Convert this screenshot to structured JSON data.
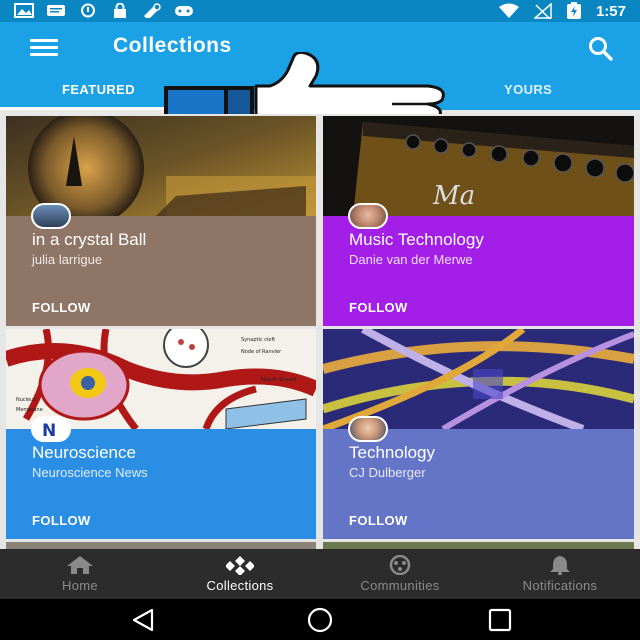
{
  "status_bar": {
    "time": "1:57",
    "icons": [
      "gallery-icon",
      "message-icon",
      "sync-icon",
      "lock-icon",
      "tool-icon",
      "gamepad-icon",
      "wifi-icon",
      "no-signal-icon",
      "battery-charging-icon"
    ]
  },
  "app_bar": {
    "title": "Collections",
    "menu_icon": "menu-icon",
    "search_icon": "search-icon",
    "tabs": [
      {
        "label": "FEATURED",
        "active": true
      },
      {
        "label": "YOURS",
        "active": false
      }
    ]
  },
  "overlay": {
    "icon": "thumbs-up-icon",
    "colors": {
      "cuff": "#1a74c8",
      "hand": "#ffffff",
      "outline": "#111111"
    }
  },
  "cards": [
    {
      "title": "in a crystal Ball",
      "author": "julia larrigue",
      "follow": "FOLLOW",
      "color": "#8f7566",
      "image": "crystal-ball-paris-image"
    },
    {
      "title": "Music Technology",
      "author": "Danie van der Merwe",
      "follow": "FOLLOW",
      "color": "#a31ee6",
      "image": "amplifier-image"
    },
    {
      "title": "Neuroscience",
      "author": "Neuroscience News",
      "follow": "FOLLOW",
      "color": "#2a8fe4",
      "image": "neuron-diagram-image"
    },
    {
      "title": "Technology",
      "author": "CJ Dulberger",
      "follow": "FOLLOW",
      "color": "#6475c7",
      "image": "highway-interchange-image"
    }
  ],
  "bottom_nav": [
    {
      "label": "Home",
      "icon": "home-icon",
      "active": false
    },
    {
      "label": "Collections",
      "icon": "collections-icon",
      "active": true
    },
    {
      "label": "Communities",
      "icon": "communities-icon",
      "active": false
    },
    {
      "label": "Notifications",
      "icon": "bell-icon",
      "active": false
    }
  ],
  "system_nav": [
    "back-icon",
    "home-circle-icon",
    "recents-icon"
  ],
  "colors": {
    "status_bar": "#0a86c2",
    "app_bar": "#1aa1e6",
    "bottom_nav": "#2c2c2c"
  }
}
